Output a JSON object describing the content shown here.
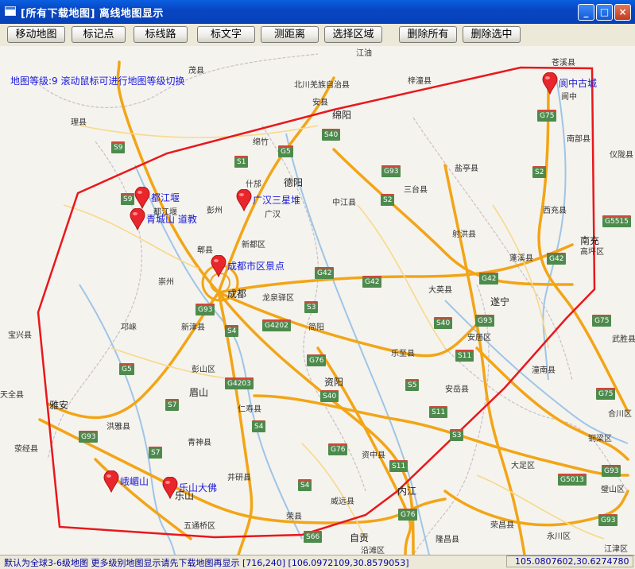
{
  "window": {
    "title": "[所有下载地图] 离线地图显示",
    "minimize": "_",
    "maximize": "□",
    "close": "×"
  },
  "toolbar": {
    "buttons": [
      "移动地图",
      "标记点",
      "标线路",
      "标文字",
      "测距离",
      "选择区域",
      "删除所有",
      "删除选中"
    ]
  },
  "map": {
    "zoom_hint": "地图等级:9  滚动鼠标可进行地图等级切换",
    "markers": [
      {
        "label": "阆中古城"
      },
      {
        "label": "都江堰"
      },
      {
        "label": "广汉三星堆"
      },
      {
        "label": "青城山 道教"
      },
      {
        "label": "成都市区景点"
      },
      {
        "label": "峨嵋山"
      },
      {
        "label": "乐山大佛"
      }
    ],
    "cities": [
      "江油",
      "苍溪县",
      "茂县",
      "北川羌族自治县",
      "梓潼县",
      "安县",
      "阆中",
      "理县",
      "绵阳",
      "南部县",
      "仪陇县",
      "绵竹",
      "盐亭县",
      "什邡",
      "德阳",
      "三台县",
      "都江堰",
      "中江县",
      "广汉",
      "西充县",
      "彭州",
      "射洪县",
      "新都区",
      "郫县",
      "南充",
      "高坪区",
      "蓬溪县",
      "崇州",
      "成都",
      "龙泉驿区",
      "大英县",
      "遂宁",
      "邛崃",
      "新津县",
      "简阳",
      "安居区",
      "宝兴县",
      "乐至县",
      "武胜县",
      "彭山区",
      "资阳",
      "潼南县",
      "天全县",
      "眉山",
      "安岳县",
      "雅安",
      "仁寿县",
      "合川区",
      "洪雅县",
      "荥经县",
      "青神县",
      "铜梁区",
      "资中县",
      "大足区",
      "井研县",
      "乐山",
      "内江",
      "威远县",
      "璧山区",
      "五通桥区",
      "荣县",
      "荣昌县",
      "永川区",
      "自贡",
      "隆昌县",
      "沿滩区",
      "江津区"
    ],
    "highways": [
      "G75",
      "S9",
      "G5",
      "S40",
      "S1",
      "G93",
      "S2",
      "G5515",
      "G42",
      "S9",
      "S2",
      "G42",
      "G42",
      "G42",
      "G93",
      "S3",
      "G93",
      "S40",
      "G75",
      "G4202",
      "S4",
      "G76",
      "S11",
      "S40",
      "G5",
      "G4203",
      "S5",
      "G75",
      "S7",
      "S11",
      "S3",
      "G93",
      "S4",
      "S7",
      "G76",
      "G5013",
      "G93",
      "S4",
      "S11",
      "G76",
      "S66",
      "G93"
    ]
  },
  "status": {
    "left": "默认为全球3-6级地图 更多级别地图显示请先下载地图再显示 [716,240] [106.0972109,30.8579053]",
    "right": "105.0807602,30.6274780"
  },
  "colors": {
    "title_blue": "#0a5fe0",
    "region_line": "#e8181c",
    "marker_red": "#e8262b",
    "highway": "#f2a516",
    "label_blue": "#1a1ad8"
  }
}
